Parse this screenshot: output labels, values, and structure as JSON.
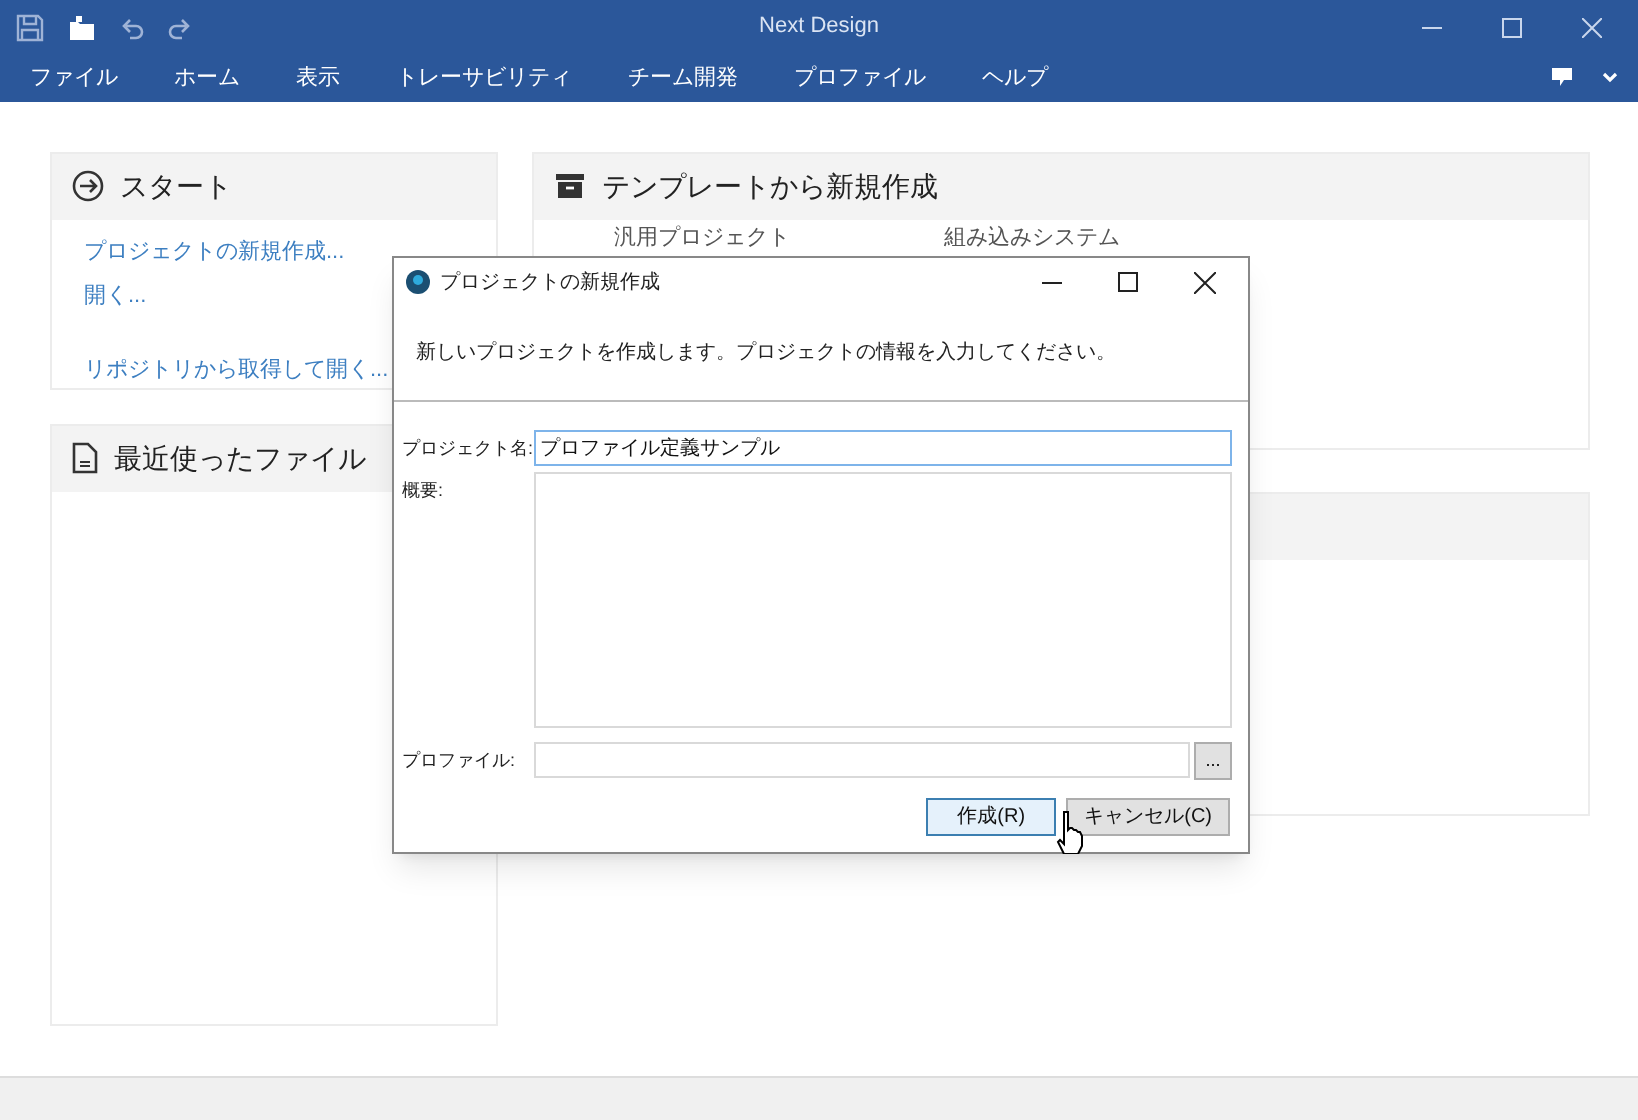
{
  "window": {
    "title": "Next Design"
  },
  "menu": [
    "ファイル",
    "ホーム",
    "表示",
    "トレーサビリティ",
    "チーム開発",
    "プロファイル",
    "ヘルプ"
  ],
  "start": {
    "title": "スタート",
    "links": [
      "プロジェクトの新規作成...",
      "開く...",
      "リポジトリから取得して開く..."
    ]
  },
  "recent": {
    "title": "最近使ったファイル"
  },
  "templates": {
    "title": "テンプレートから新規作成",
    "items": [
      "汎用プロジェクト",
      "組み込みシステム"
    ]
  },
  "dialog": {
    "title": "プロジェクトの新規作成",
    "message": "新しいプロジェクトを作成します。プロジェクトの情報を入力してください。",
    "fields": [
      {
        "label": "プロジェクト名:",
        "value": "プロファイル定義サンプル",
        "focused": true
      },
      {
        "label": "概要:",
        "focused": false
      },
      {
        "label": "プロファイル:",
        "focused": false
      }
    ],
    "browse": "...",
    "buttons": [
      {
        "label": "作成(R)",
        "selected": true
      },
      {
        "label": "キャンセル(C)",
        "selected": false
      }
    ]
  }
}
